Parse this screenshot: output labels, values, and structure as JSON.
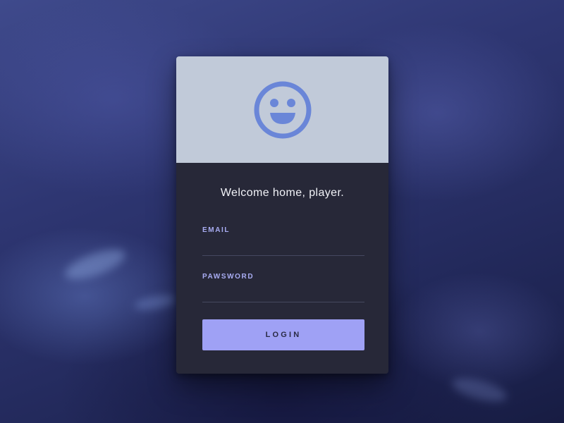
{
  "colors": {
    "header_bg": "#c1cad9",
    "body_bg": "#272838",
    "accent": "#9fa1f5",
    "icon": "#6a86d8",
    "label": "#a9adf3"
  },
  "header": {
    "icon": "smiley-face-icon"
  },
  "form": {
    "title": "Welcome home, player.",
    "email": {
      "label": "EMAIL",
      "value": "",
      "placeholder": ""
    },
    "password": {
      "label": "PAWSWORD",
      "value": "",
      "placeholder": ""
    },
    "login_label": "LOGIN"
  }
}
